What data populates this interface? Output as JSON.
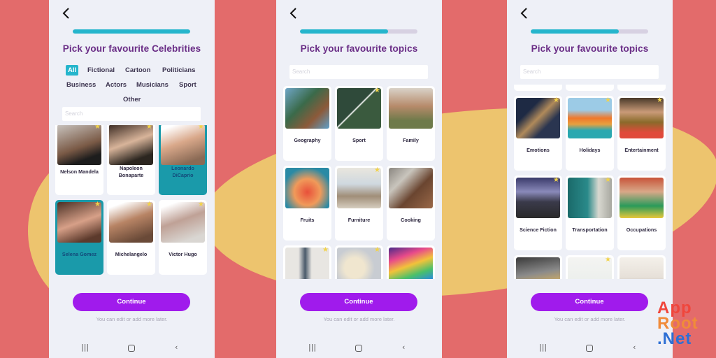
{
  "colors": {
    "background": "#e36b6b",
    "blob": "#edc46e",
    "accent_teal": "#25b5cc",
    "title_purple": "#6a2d86",
    "button_purple": "#a01bec"
  },
  "screens": [
    {
      "title": "Pick your favourite Celebrities",
      "progress_percent": 100,
      "search_placeholder": "Search",
      "filters": [
        {
          "label": "All",
          "active": true
        },
        {
          "label": "Fictional",
          "active": false
        },
        {
          "label": "Cartoon",
          "active": false
        },
        {
          "label": "Politicians",
          "active": false
        },
        {
          "label": "Business",
          "active": false
        },
        {
          "label": "Actors",
          "active": false
        },
        {
          "label": "Musicians",
          "active": false
        },
        {
          "label": "Sport",
          "active": false
        },
        {
          "label": "Other",
          "active": false
        }
      ],
      "cards": [
        {
          "label": "Nelson Mandela",
          "selected": false
        },
        {
          "label": "Napoleon Bonaparte",
          "selected": false
        },
        {
          "label": "Leonardo DiCaprio",
          "selected": true
        },
        {
          "label": "Selena Gomez",
          "selected": true
        },
        {
          "label": "Michelangelo",
          "selected": false
        },
        {
          "label": "Victor Hugo",
          "selected": false
        }
      ],
      "continue_label": "Continue",
      "hint": "You can edit or add more later."
    },
    {
      "title": "Pick your favourite topics",
      "progress_percent": 75,
      "search_placeholder": "Search",
      "cards": [
        {
          "label": "Geography",
          "selected": false
        },
        {
          "label": "Sport",
          "selected": false
        },
        {
          "label": "Family",
          "selected": false
        },
        {
          "label": "Fruits",
          "selected": false
        },
        {
          "label": "Furniture",
          "selected": false
        },
        {
          "label": "Cooking",
          "selected": false
        },
        {
          "label": "",
          "selected": false
        },
        {
          "label": "",
          "selected": false
        },
        {
          "label": "",
          "selected": false
        }
      ],
      "continue_label": "Continue",
      "hint": "You can edit or add more later."
    },
    {
      "title": "Pick your favourite topics",
      "progress_percent": 75,
      "search_placeholder": "Search",
      "cards": [
        {
          "label": "Emotions",
          "selected": false
        },
        {
          "label": "Holidays",
          "selected": false
        },
        {
          "label": "Entertainment",
          "selected": false
        },
        {
          "label": "Science Fiction",
          "selected": false
        },
        {
          "label": "Transportation",
          "selected": false
        },
        {
          "label": "Occupations",
          "selected": false
        },
        {
          "label": "",
          "selected": false
        },
        {
          "label": "",
          "selected": false
        },
        {
          "label": "",
          "selected": false
        }
      ],
      "continue_label": "Continue",
      "hint": "You can edit or add more later."
    }
  ],
  "nav": {
    "recents": "recents-icon",
    "home": "home-icon",
    "back": "back-icon"
  },
  "logo": {
    "line1": "App",
    "line2": "Root",
    "line3": ".Net"
  }
}
